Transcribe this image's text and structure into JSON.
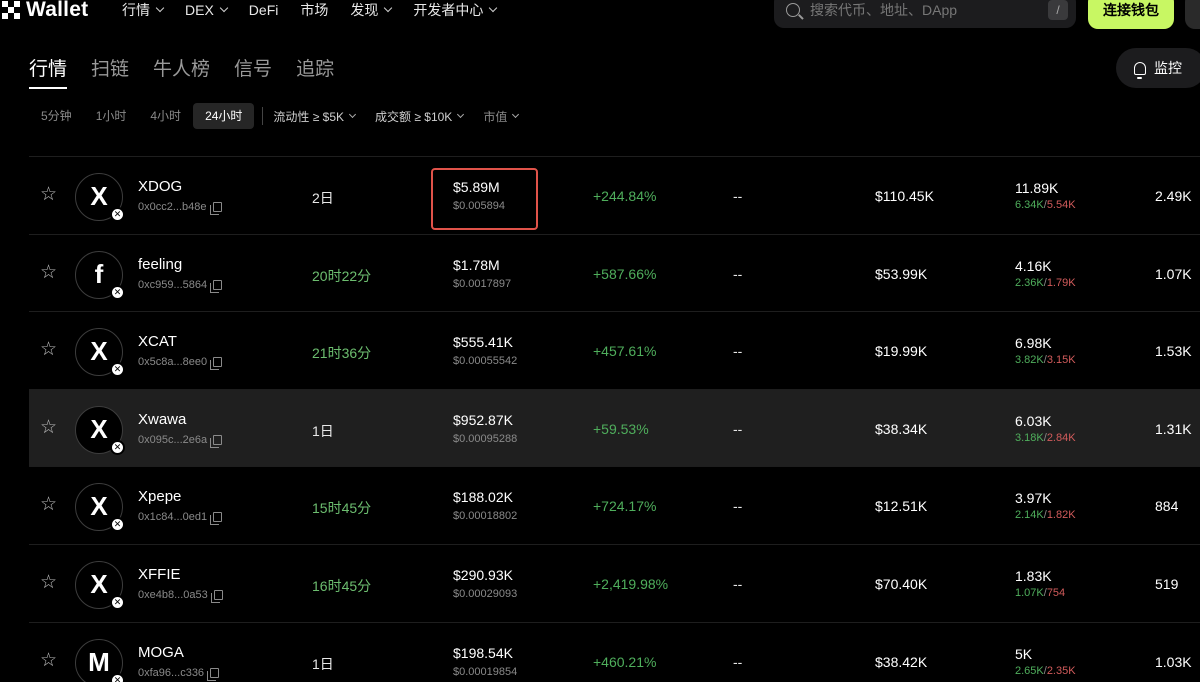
{
  "nav": {
    "logo": "Wallet",
    "menu": [
      {
        "label": "行情",
        "dropdown": true
      },
      {
        "label": "DEX",
        "dropdown": true
      },
      {
        "label": "DeFi",
        "dropdown": false
      },
      {
        "label": "市场",
        "dropdown": false
      },
      {
        "label": "发现",
        "dropdown": true
      },
      {
        "label": "开发者中心",
        "dropdown": true
      }
    ],
    "search_placeholder": "搜索代币、地址、DApp",
    "search_shortcut": "/",
    "connect_label": "连接钱包"
  },
  "tabs": [
    "行情",
    "扫链",
    "牛人榜",
    "信号",
    "追踪"
  ],
  "active_tab": 0,
  "monitor_label": "监控",
  "filters": {
    "time_ranges": [
      "5分钟",
      "1小时",
      "4小时",
      "24小时"
    ],
    "active_time": 3,
    "dropdowns": [
      {
        "label": "流动性 ≥ $5K"
      },
      {
        "label": "成交额 ≥ $10K"
      },
      {
        "label": "市值"
      }
    ]
  },
  "rows": [
    {
      "icon": "X",
      "name": "XDOG",
      "address": "0x0cc2...b48e",
      "age": "2日",
      "age_recent": false,
      "market_cap": "$5.89M",
      "price": "$0.005894",
      "change": "+244.84%",
      "dash": "--",
      "liquidity": "$110.45K",
      "txns": "11.89K",
      "buys": "6.34K",
      "sells": "5.54K",
      "holders": "2.49K",
      "highlighted": false
    },
    {
      "icon": "f",
      "name": "feeling",
      "address": "0xc959...5864",
      "age": "20时22分",
      "age_recent": true,
      "market_cap": "$1.78M",
      "price": "$0.0017897",
      "change": "+587.66%",
      "dash": "--",
      "liquidity": "$53.99K",
      "txns": "4.16K",
      "buys": "2.36K",
      "sells": "1.79K",
      "holders": "1.07K",
      "highlighted": false
    },
    {
      "icon": "X",
      "name": "XCAT",
      "address": "0x5c8a...8ee0",
      "age": "21时36分",
      "age_recent": true,
      "market_cap": "$555.41K",
      "price": "$0.00055542",
      "change": "+457.61%",
      "dash": "--",
      "liquidity": "$19.99K",
      "txns": "6.98K",
      "buys": "3.82K",
      "sells": "3.15K",
      "holders": "1.53K",
      "highlighted": false
    },
    {
      "icon": "X",
      "name": "Xwawa",
      "address": "0x095c...2e6a",
      "age": "1日",
      "age_recent": false,
      "market_cap": "$952.87K",
      "price": "$0.00095288",
      "change": "+59.53%",
      "dash": "--",
      "liquidity": "$38.34K",
      "txns": "6.03K",
      "buys": "3.18K",
      "sells": "2.84K",
      "holders": "1.31K",
      "highlighted": true
    },
    {
      "icon": "X",
      "name": "Xpepe",
      "address": "0x1c84...0ed1",
      "age": "15时45分",
      "age_recent": true,
      "market_cap": "$188.02K",
      "price": "$0.00018802",
      "change": "+724.17%",
      "dash": "--",
      "liquidity": "$12.51K",
      "txns": "3.97K",
      "buys": "2.14K",
      "sells": "1.82K",
      "holders": "884",
      "highlighted": false
    },
    {
      "icon": "X",
      "name": "XFFIE",
      "address": "0xe4b8...0a53",
      "age": "16时45分",
      "age_recent": true,
      "market_cap": "$290.93K",
      "price": "$0.00029093",
      "change": "+2,419.98%",
      "dash": "--",
      "liquidity": "$70.40K",
      "txns": "1.83K",
      "buys": "1.07K",
      "sells": "754",
      "holders": "519",
      "highlighted": false
    },
    {
      "icon": "M",
      "name": "MOGA",
      "address": "0xfa96...c336",
      "age": "1日",
      "age_recent": false,
      "market_cap": "$198.54K",
      "price": "$0.00019854",
      "change": "+460.21%",
      "dash": "--",
      "liquidity": "$38.42K",
      "txns": "5K",
      "buys": "2.65K",
      "sells": "2.35K",
      "holders": "1.03K",
      "highlighted": false
    }
  ]
}
